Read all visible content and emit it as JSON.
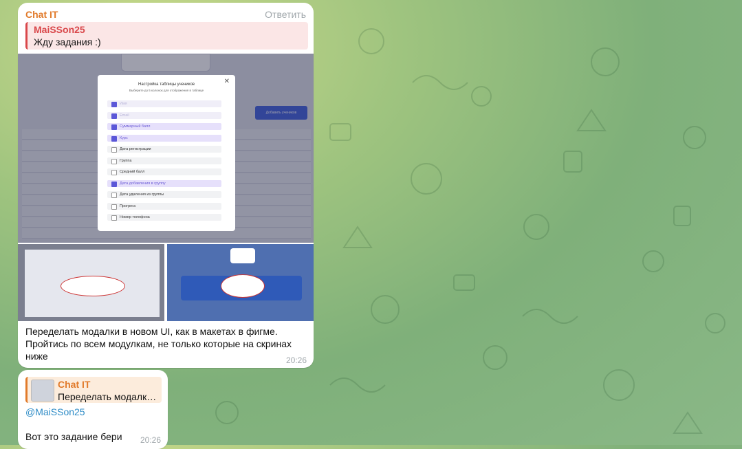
{
  "messages": [
    {
      "sender": "Chat IT",
      "reply_action": "Ответить",
      "quote": {
        "name": "MaiSSon25",
        "text": "Жду задания :)"
      },
      "screenshot": {
        "modal_title": "Настройка таблицы учеников",
        "modal_subtitle": "Выберите до 5 колонок для отображения в таблице",
        "add_button": "Добавить учеников",
        "options": [
          {
            "label": "Имя",
            "state": "disabled"
          },
          {
            "label": "Email",
            "state": "disabled"
          },
          {
            "label": "Суммарный балл",
            "state": "selected"
          },
          {
            "label": "Курс",
            "state": "selected"
          },
          {
            "label": "Дата регистрации",
            "state": "off"
          },
          {
            "label": "Группа",
            "state": "off"
          },
          {
            "label": "Средний балл",
            "state": "off"
          },
          {
            "label": "Дата добавления в группу",
            "state": "selected"
          },
          {
            "label": "Дата удаления из группы",
            "state": "off"
          },
          {
            "label": "Прогресс",
            "state": "off"
          },
          {
            "label": "Номер телефона",
            "state": "off"
          }
        ]
      },
      "caption": "Переделать модалки в новом UI, как в макетах в фигме. Пройтись по всем модулкам, не только которые на скринах ниже",
      "time": "20:26"
    },
    {
      "quote": {
        "name": "Chat IT",
        "text": "Переделать модалки ..."
      },
      "mention": "@MaiSSon25",
      "text": "Вот это задание бери",
      "time": "20:26"
    }
  ]
}
